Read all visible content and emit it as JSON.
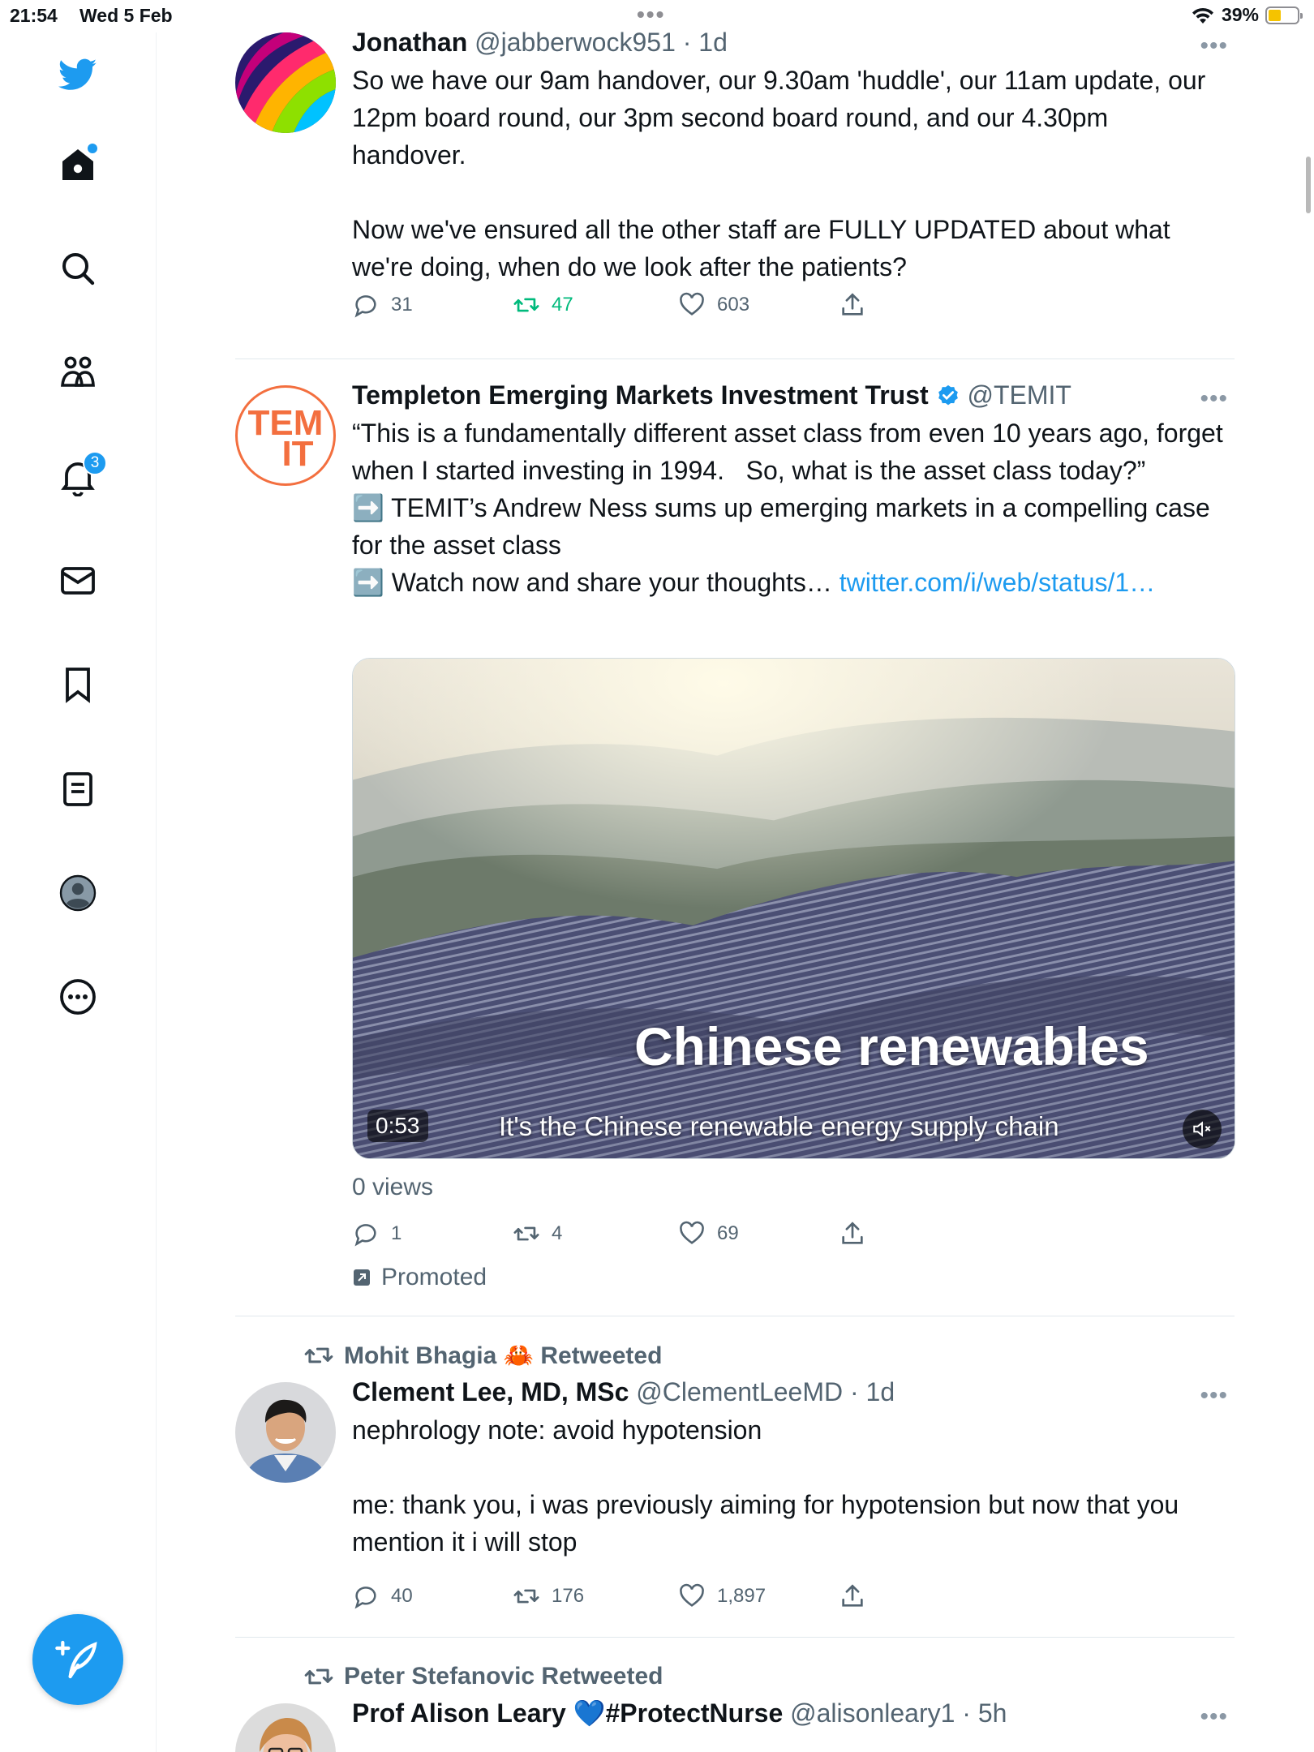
{
  "status_bar": {
    "time": "21:54",
    "date": "Wed 5 Feb",
    "battery": "39%",
    "battery_level": 0.39
  },
  "sidebar": {
    "items": [
      {
        "icon": "home-icon",
        "label": "Home",
        "has_dot": true
      },
      {
        "icon": "search-icon",
        "label": "Explore"
      },
      {
        "icon": "communities-icon",
        "label": "Communities"
      },
      {
        "icon": "bell-icon",
        "label": "Notifications",
        "badge": "3"
      },
      {
        "icon": "mail-icon",
        "label": "Messages"
      },
      {
        "icon": "bookmark-icon",
        "label": "Bookmarks"
      },
      {
        "icon": "lists-icon",
        "label": "Lists"
      },
      {
        "icon": "profile-icon",
        "label": "Profile"
      },
      {
        "icon": "more-circle-icon",
        "label": "More"
      }
    ],
    "compose_icon": "compose-icon"
  },
  "colors": {
    "brand": "#1d9bf0",
    "retweet_active": "#00ba7c",
    "muted": "#536471"
  },
  "tweets": [
    {
      "name": "Jonathan",
      "handle": "@jabberwock951",
      "time": "· 1d",
      "text": "So we have our 9am handover, our 9.30am 'huddle', our 11am update, our 12pm board round, our 3pm second board round, and our 4.30pm handover.\n\nNow we've ensured all the other staff are FULLY UPDATED about what we're doing, when do we look after the patients?",
      "replies": "31",
      "retweets": "47",
      "likes": "603"
    },
    {
      "name": "Templeton Emerging Markets Investment Trust",
      "handle": "@TEMIT",
      "avatar_text": "TEM IT",
      "text": "“This is a fundamentally different asset class from even 10 years ago, forget when I started investing in 1994.   So, what is the asset class today?”\n➡️ TEMIT’s Andrew Ness sums up emerging markets in a compelling case for the asset class\n➡️ Watch now and share your thoughts… ",
      "link": "twitter.com/i/web/status/1…",
      "video": {
        "title_overlay": "Chinese renewables",
        "subtitle": "It's the Chinese renewable energy supply chain",
        "duration": "0:53"
      },
      "views": "0 views",
      "replies": "1",
      "retweets": "4",
      "likes": "69",
      "promoted": "Promoted"
    },
    {
      "retweeted_by": "Mohit Bhagia 🦀 Retweeted",
      "name": "Clement Lee, MD, MSc",
      "handle": "@ClementLeeMD",
      "time": "· 1d",
      "text": "nephrology note: avoid hypotension\n\nme: thank you, i was previously aiming for hypotension but now that you mention it i will stop",
      "replies": "40",
      "retweets": "176",
      "likes": "1,897"
    },
    {
      "retweeted_by": "Peter Stefanovic Retweeted",
      "name": "Prof Alison Leary 💙#ProtectNurse",
      "handle": "@alisonleary1",
      "time": "· 5h"
    }
  ]
}
